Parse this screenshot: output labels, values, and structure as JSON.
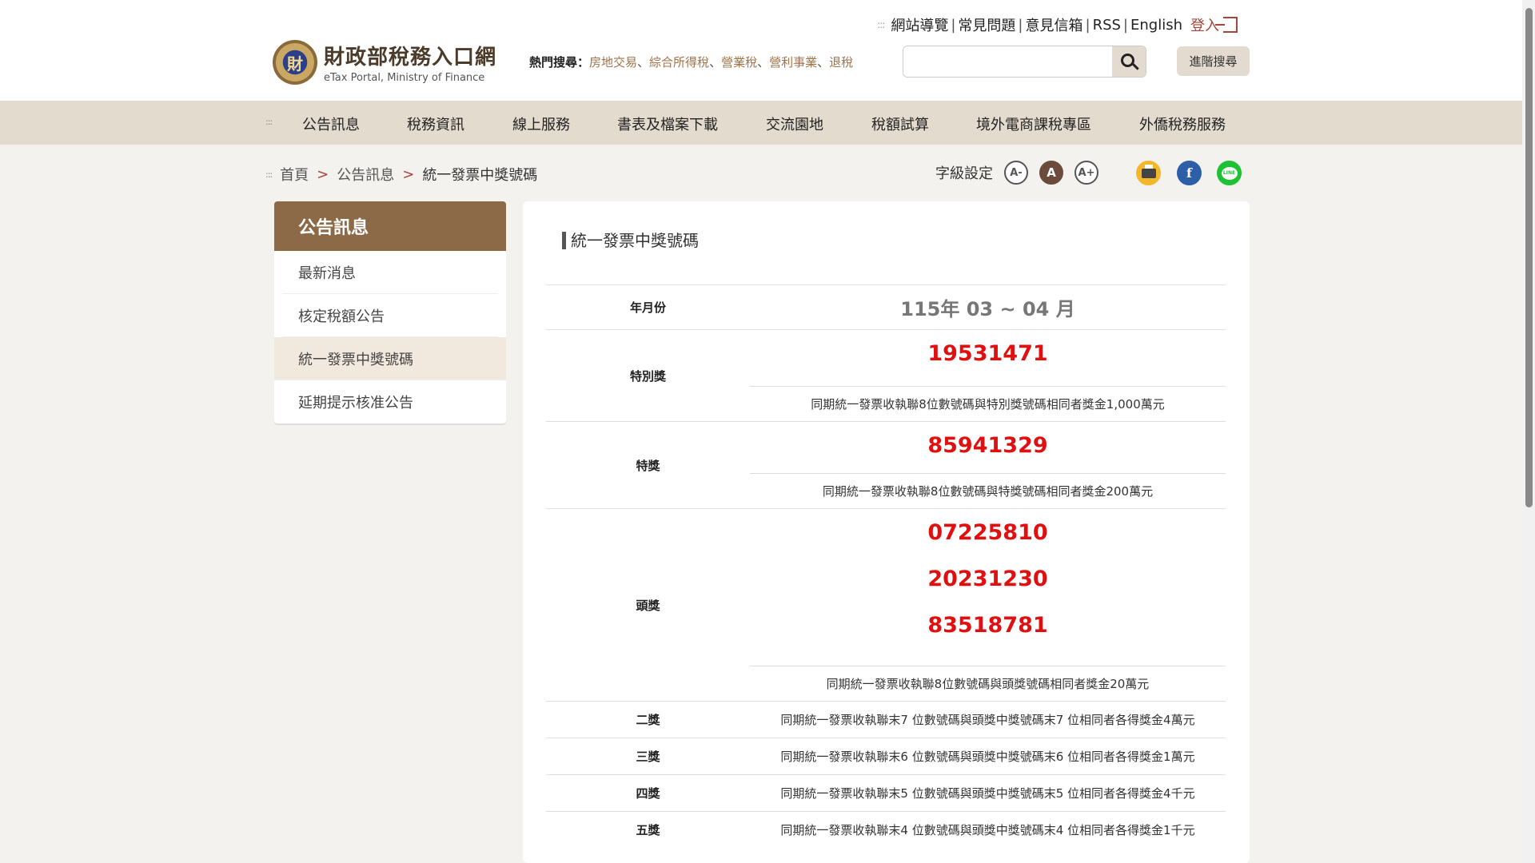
{
  "header": {
    "logo_title": "財政部稅務入口網",
    "logo_subtitle": "eTax Portal, Ministry of Finance",
    "top_links": [
      "網站導覽",
      "常見問題",
      "意見信箱",
      "RSS",
      "English"
    ],
    "login_label": "登入",
    "hot_search_label": "熱門搜尋：",
    "hot_search_links": [
      "房地交易",
      "綜合所得稅",
      "營業稅",
      "營利事業",
      "退稅"
    ],
    "search_placeholder": "",
    "advanced_search_label": "進階搜尋"
  },
  "nav": {
    "items": [
      "公告訊息",
      "稅務資訊",
      "線上服務",
      "書表及檔案下載",
      "交流園地",
      "稅額試算",
      "境外電商課稅專區",
      "外僑稅務服務"
    ]
  },
  "breadcrumb": {
    "items": [
      "首頁",
      "公告訊息",
      "統一發票中獎號碼"
    ]
  },
  "font_setting": {
    "label": "字級設定",
    "smaller": "A-",
    "normal": "A",
    "larger": "A+"
  },
  "sidebar": {
    "title": "公告訊息",
    "items": [
      "最新消息",
      "核定稅額公告",
      "統一發票中獎號碼",
      "延期提示核准公告"
    ],
    "active_index": 2
  },
  "main": {
    "title": "統一發票中獎號碼",
    "period_label": "年月份",
    "period_value": "115年 03 ~ 04 月",
    "special_prize": {
      "label": "特別獎",
      "numbers": [
        "19531471"
      ],
      "desc": "同期統一發票收執聯8位數號碼與特別獎號碼相同者獎金1,000萬元"
    },
    "grand_prize": {
      "label": "特獎",
      "numbers": [
        "85941329"
      ],
      "desc": "同期統一發票收執聯8位數號碼與特獎號碼相同者獎金200萬元"
    },
    "first_prize": {
      "label": "頭獎",
      "numbers": [
        "07225810",
        "20231230",
        "83518781"
      ],
      "desc": "同期統一發票收執聯8位數號碼與頭獎號碼相同者獎金20萬元"
    },
    "other_prizes": [
      {
        "label": "二獎",
        "desc": "同期統一發票收執聯末7 位數號碼與頭獎中獎號碼末7 位相同者各得獎金4萬元"
      },
      {
        "label": "三獎",
        "desc": "同期統一發票收執聯末6 位數號碼與頭獎中獎號碼末6 位相同者各得獎金1萬元"
      },
      {
        "label": "四獎",
        "desc": "同期統一發票收執聯末5 位數號碼與頭獎中獎號碼末5 位相同者各得獎金4千元"
      },
      {
        "label": "五獎",
        "desc": "同期統一發票收執聯末4 位數號碼與頭獎中獎號碼末4 位相同者各得獎金1千元"
      }
    ]
  },
  "colors": {
    "accent_brown": "#8c6a47",
    "nav_bg": "#e4dbcf",
    "prize_red": "#e01010"
  }
}
